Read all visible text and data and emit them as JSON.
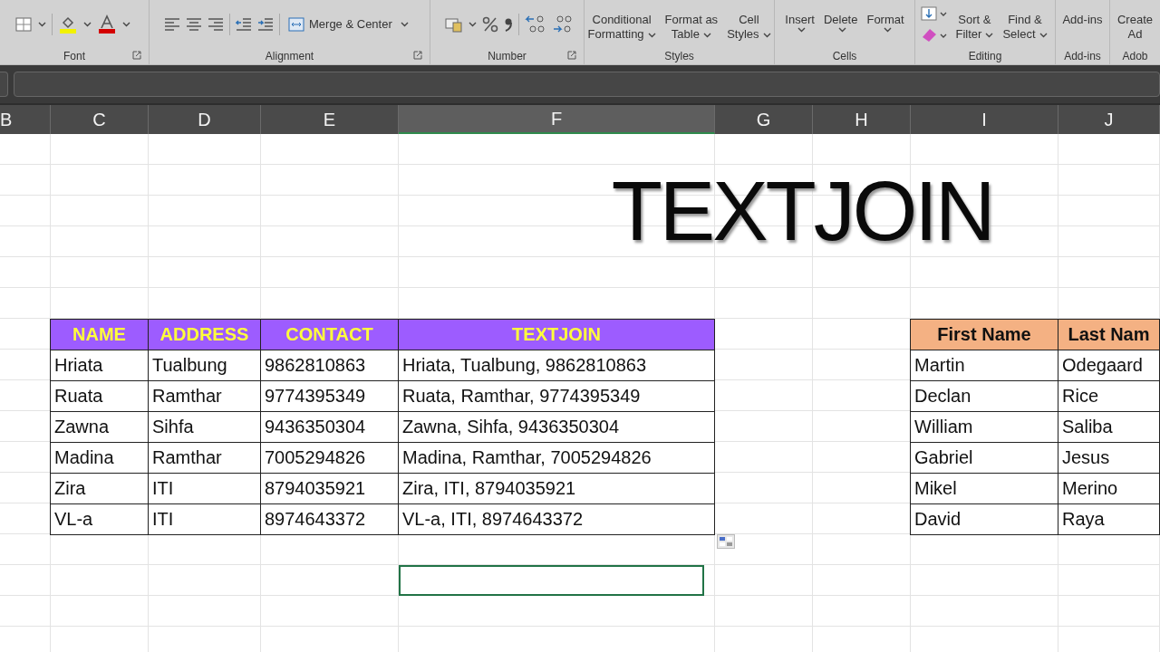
{
  "ribbon": {
    "groups": [
      {
        "kind": "font",
        "label": "Font",
        "launcher": true
      },
      {
        "kind": "alignment",
        "label": "Alignment",
        "launcher": true,
        "buttons": [
          {
            "lines": [
              "Merge & Center"
            ],
            "dropdown": true
          }
        ]
      },
      {
        "kind": "number",
        "label": "Number",
        "launcher": true
      },
      {
        "kind": "buttons",
        "label": "Styles",
        "launcher": false,
        "buttons": [
          {
            "lines": [
              "Conditional",
              "Formatting"
            ],
            "dropdown": true
          },
          {
            "lines": [
              "Format as",
              "Table"
            ],
            "dropdown": true
          },
          {
            "lines": [
              "Cell",
              "Styles"
            ],
            "dropdown": true
          }
        ]
      },
      {
        "kind": "buttons",
        "label": "Cells",
        "launcher": false,
        "buttons": [
          {
            "lines": [
              "Insert"
            ],
            "dropdown": true
          },
          {
            "lines": [
              "Delete"
            ],
            "dropdown": true
          },
          {
            "lines": [
              "Format"
            ],
            "dropdown": true
          }
        ]
      },
      {
        "kind": "editing",
        "label": "Editing",
        "launcher": false,
        "buttons": [
          {
            "lines": [
              "Sort &",
              "Filter"
            ],
            "dropdown": true
          },
          {
            "lines": [
              "Find &",
              "Select"
            ],
            "dropdown": true
          }
        ]
      },
      {
        "kind": "buttons",
        "label": "Add-ins",
        "launcher": false,
        "buttons": [
          {
            "lines": [
              "Add-ins"
            ],
            "dropdown": false
          }
        ]
      },
      {
        "kind": "buttons",
        "label": "Adob",
        "launcher": false,
        "buttons": [
          {
            "lines": [
              "Create",
              "Ad"
            ],
            "dropdown": false
          }
        ]
      }
    ]
  },
  "column_headers": [
    {
      "label": "B",
      "selected": false
    },
    {
      "label": "C",
      "selected": false
    },
    {
      "label": "D",
      "selected": false
    },
    {
      "label": "E",
      "selected": false
    },
    {
      "label": "F",
      "selected": true
    },
    {
      "label": "G",
      "selected": false
    },
    {
      "label": "H",
      "selected": false
    },
    {
      "label": "I",
      "selected": false
    },
    {
      "label": "J",
      "selected": false
    }
  ],
  "sheet": {
    "title": "TEXTJOIN",
    "table_1": {
      "columns": [
        "NAME",
        "ADDRESS",
        "CONTACT",
        "TEXTJOIN"
      ],
      "rows": [
        [
          "Hriata",
          "Tualbung",
          "9862810863",
          "Hriata, Tualbung, 9862810863"
        ],
        [
          "Ruata",
          "Ramthar",
          "9774395349",
          "Ruata, Ramthar, 9774395349"
        ],
        [
          "Zawna",
          "Sihfa",
          "9436350304",
          "Zawna, Sihfa, 9436350304"
        ],
        [
          "Madina",
          "Ramthar",
          "7005294826",
          "Madina, Ramthar, 7005294826"
        ],
        [
          "Zira",
          "ITI",
          "8794035921",
          "Zira, ITI, 8794035921"
        ],
        [
          "VL-a",
          "ITI",
          "8974643372",
          "VL-a, ITI, 8974643372"
        ]
      ]
    },
    "table_2": {
      "columns": [
        "First Name",
        "Last Nam"
      ],
      "rows": [
        [
          "Martin",
          "Odegaard"
        ],
        [
          "Declan",
          "Rice"
        ],
        [
          "William",
          "Saliba"
        ],
        [
          "Gabriel",
          "Jesus"
        ],
        [
          "Mikel",
          "Merino"
        ],
        [
          "David",
          "Raya"
        ]
      ]
    }
  }
}
